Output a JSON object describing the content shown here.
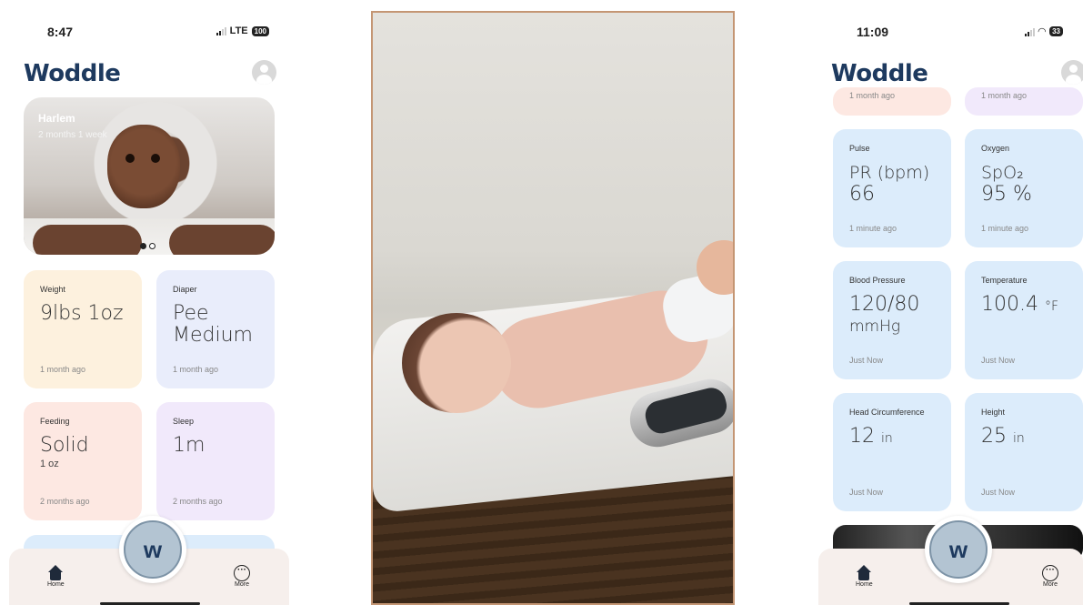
{
  "left_phone": {
    "status": {
      "time": "8:47",
      "network": "LTE",
      "battery": "100"
    },
    "brand": "Woddle",
    "hero": {
      "name": "Harlem",
      "age": "2 months 1 week"
    },
    "cards": [
      {
        "label": "Weight",
        "value": "9lbs 1oz",
        "sub": "",
        "time": "1 month ago",
        "color": "#fdf1de"
      },
      {
        "label": "Diaper",
        "value": "Pee",
        "value2": "Medium",
        "time": "1 month ago",
        "color": "#e9edfb"
      },
      {
        "label": "Feeding",
        "value": "Solid",
        "sub": "1 oz",
        "time": "2 months ago",
        "color": "#fde8e2"
      },
      {
        "label": "Sleep",
        "value": "1m",
        "sub": "",
        "time": "2 months ago",
        "color": "#f1e9fb"
      }
    ],
    "tabs": {
      "home": "Home",
      "more": "More"
    }
  },
  "right_phone": {
    "status": {
      "time": "11:09",
      "battery": "33"
    },
    "brand": "Woddle",
    "top_times": [
      "1 month ago",
      "1 month ago"
    ],
    "cards": [
      {
        "label": "Pulse",
        "value": "PR (bpm)",
        "value2": "66",
        "time": "1 minute ago"
      },
      {
        "label": "Oxygen",
        "value": "SpO₂",
        "value2": "95 %",
        "time": "1 minute ago"
      },
      {
        "label": "Blood Pressure",
        "value": "120/80",
        "value2": "mmHg",
        "time": "Just Now"
      },
      {
        "label": "Temperature",
        "value": "100.4",
        "unit": "°F",
        "time": "Just Now"
      },
      {
        "label": "Head Circumference",
        "value": "12",
        "unit": "in",
        "time": "Just Now"
      },
      {
        "label": "Height",
        "value": "25",
        "unit": "in",
        "time": "Just Now"
      }
    ],
    "tabs": {
      "home": "Home",
      "more": "More"
    }
  },
  "colors": {
    "brand": "#1e3a5f",
    "card_blue": "#dcecfb",
    "photo_border": "#c49674"
  }
}
